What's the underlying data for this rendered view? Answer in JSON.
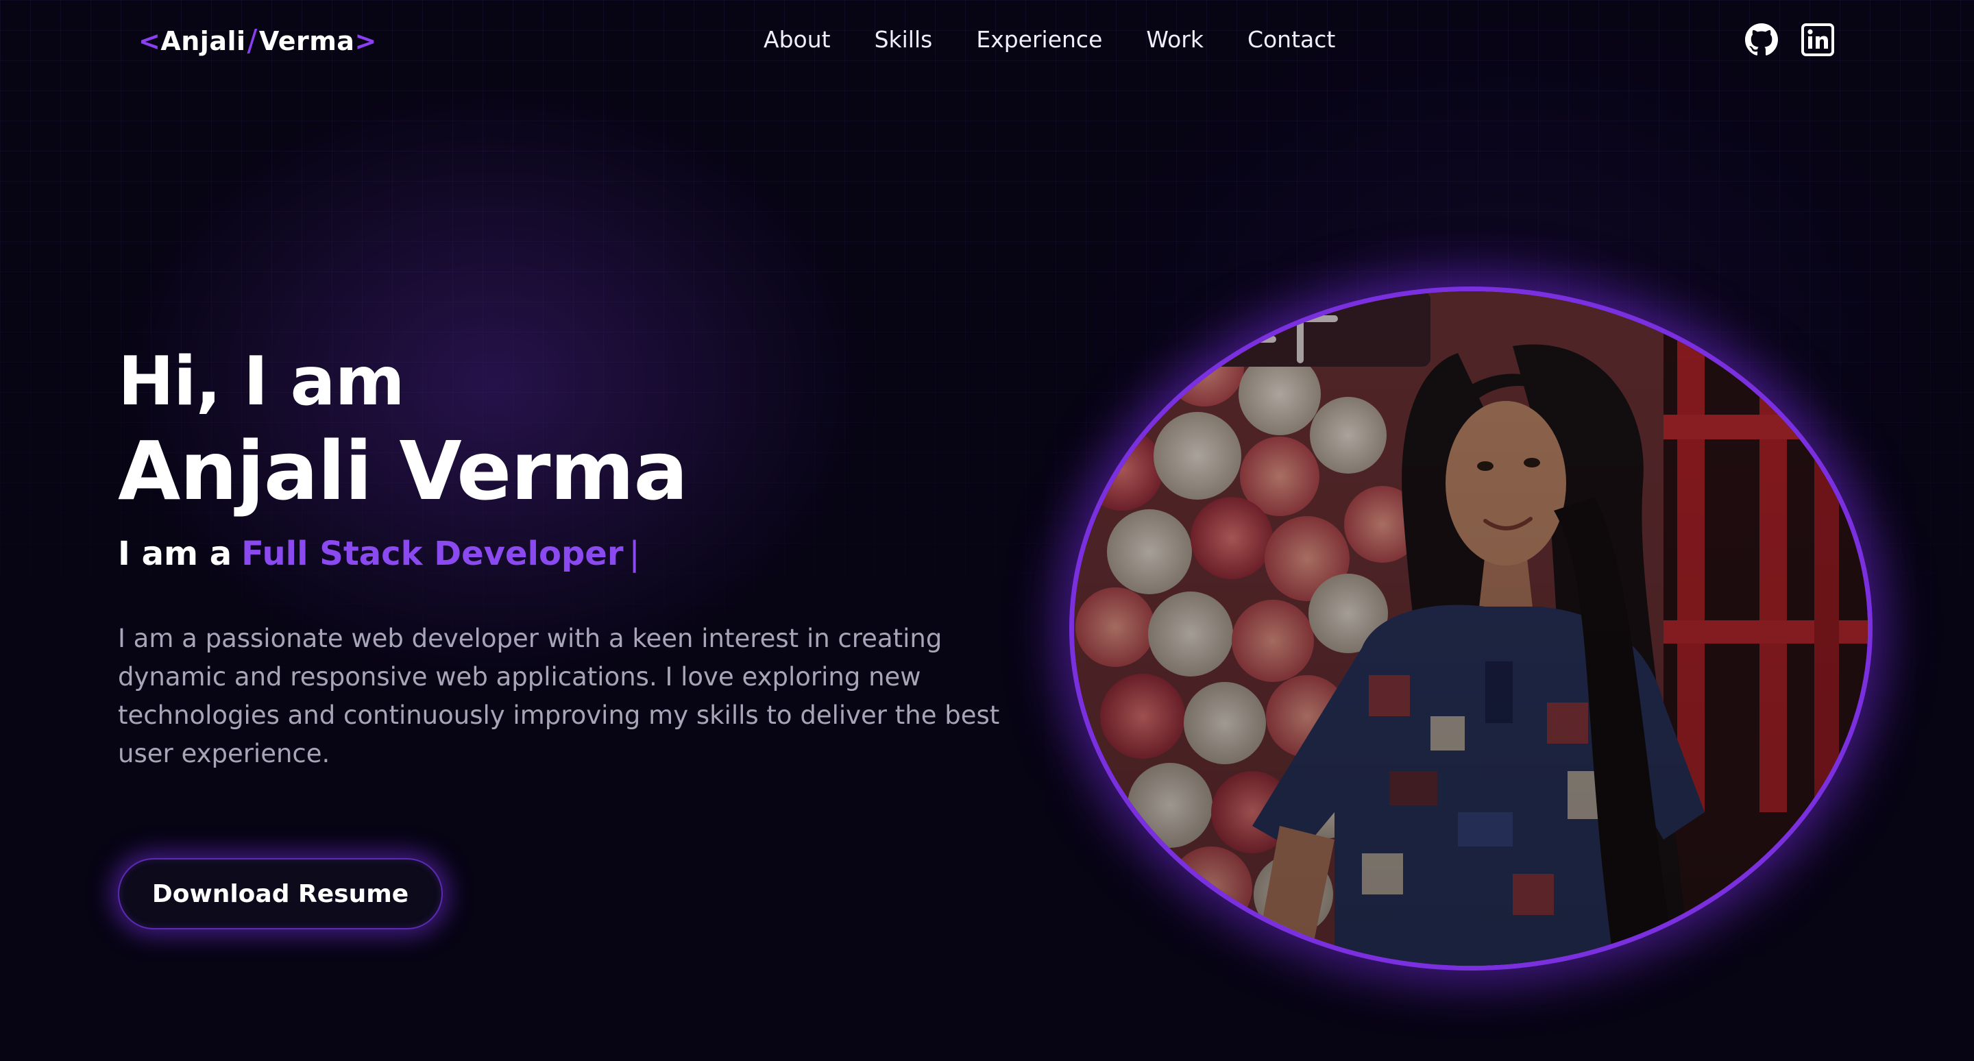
{
  "logo": {
    "open_bracket": "<",
    "first_name": "Anjali",
    "slash": "/",
    "last_name": "Verma",
    "close_bracket": ">"
  },
  "nav": {
    "items": [
      "About",
      "Skills",
      "Experience",
      "Work",
      "Contact"
    ]
  },
  "social": {
    "icons": [
      "github-icon",
      "linkedin-icon"
    ]
  },
  "hero": {
    "greeting": "Hi, I am",
    "name": "Anjali Verma",
    "role_prefix": "I am a",
    "role": "Full Stack Developer",
    "cursor": "|",
    "bio": "I am a passionate web developer with a keen interest in creating dynamic and responsive web applications. I love exploring new technologies and continuously improving my skills to deliver the best user experience.",
    "button_label": "Download Resume"
  },
  "colors": {
    "background": "#070414",
    "accent": "#8b3ff0",
    "text": "#ffffff",
    "muted_text": "#a9a5b8"
  }
}
